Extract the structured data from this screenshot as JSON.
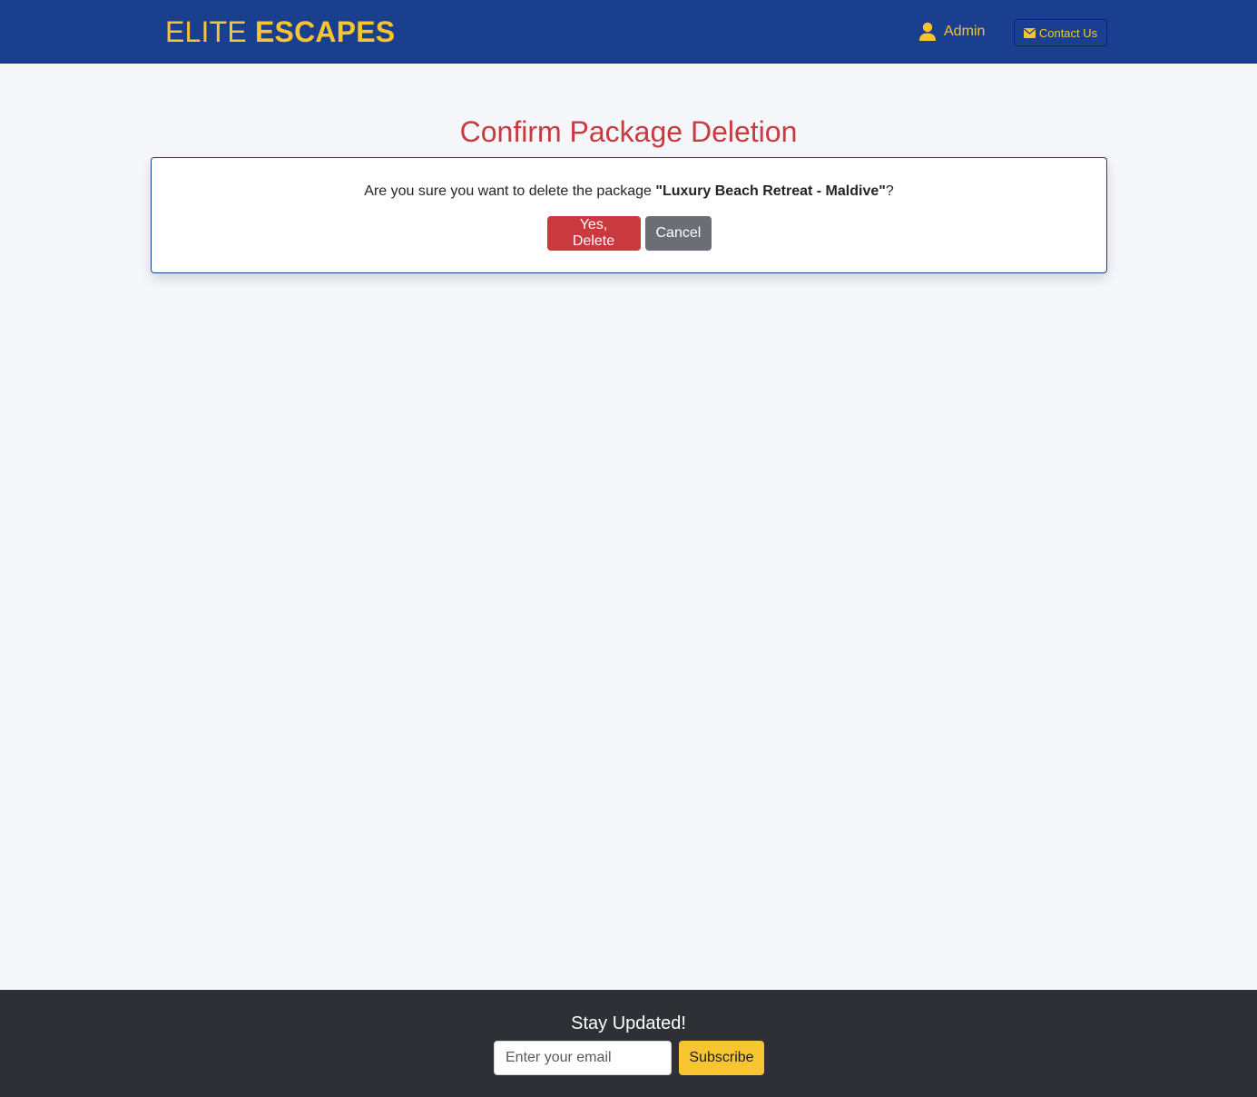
{
  "header": {
    "brand_light": "ELITE",
    "brand_bold": "ESCAPES",
    "admin_label": "Admin",
    "contact_label": "Contact Us",
    "admin_icon": "user-icon",
    "contact_icon": "envelope-icon"
  },
  "main": {
    "title": "Confirm Package Deletion",
    "prompt_prefix": "Are you sure you want to delete the package ",
    "package_name": "\"Luxury Beach Retreat - Maldive\"",
    "prompt_suffix": "?",
    "confirm_label": "Yes, Delete",
    "cancel_label": "Cancel"
  },
  "footer": {
    "title": "Stay Updated!",
    "email_placeholder": "Enter your email",
    "subscribe_label": "Subscribe"
  },
  "colors": {
    "navbar": "#1a3f8f",
    "accent": "#f7c531",
    "danger": "#c9393e",
    "secondary": "#6b6f75",
    "footer": "#2e3036"
  }
}
